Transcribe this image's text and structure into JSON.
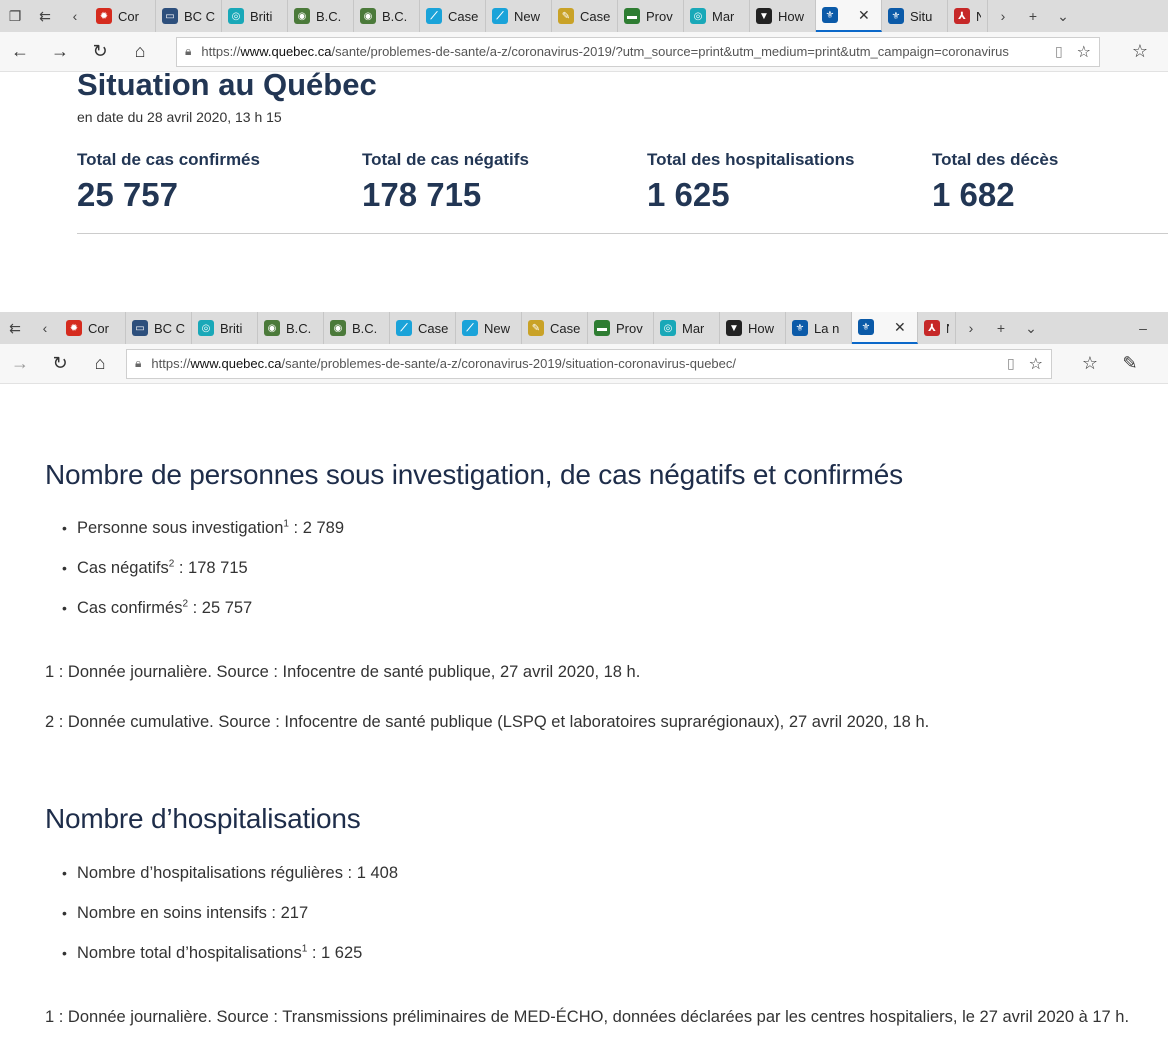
{
  "window1": {
    "tabs": [
      {
        "title": "Cor",
        "fav": "maple-leaf-icon",
        "color": "#d52b1e",
        "glyph": "✹"
      },
      {
        "title": "BC C",
        "fav": "bc-cdc-icon",
        "color": "#2d4f7c",
        "glyph": "▭"
      },
      {
        "title": "Briti",
        "fav": "news-icon",
        "color": "#19a8b8",
        "glyph": "◎"
      },
      {
        "title": "B.C.",
        "fav": "globe-icon",
        "color": "#4b7a3a",
        "glyph": "◉"
      },
      {
        "title": "B.C.",
        "fav": "globe-icon",
        "color": "#4b7a3a",
        "glyph": "◉"
      },
      {
        "title": "Case",
        "fav": "chart-icon",
        "color": "#1aa3d9",
        "glyph": "⟋"
      },
      {
        "title": "New",
        "fav": "chart-icon",
        "color": "#1aa3d9",
        "glyph": "⟋"
      },
      {
        "title": "Case",
        "fav": "doc-icon",
        "color": "#c9a227",
        "glyph": "✎"
      },
      {
        "title": "Prov",
        "fav": "gov-icon",
        "color": "#2e7d32",
        "glyph": "▬"
      },
      {
        "title": "Mar",
        "fav": "news-icon",
        "color": "#19a8b8",
        "glyph": "◎"
      },
      {
        "title": "How",
        "fav": "shield-icon",
        "color": "#222222",
        "glyph": "▼"
      },
      {
        "title": "",
        "fav": "quebec-fleur-icon",
        "color": "#0b5aa8",
        "glyph": "⚜",
        "active": true
      },
      {
        "title": "Situ",
        "fav": "quebec-fleur-icon",
        "color": "#0b5aa8",
        "glyph": "⚜"
      },
      {
        "title": "N",
        "fav": "pdf-icon",
        "color": "#c62828",
        "glyph": "⅄"
      }
    ],
    "url": {
      "prefix": "https://",
      "domain": "www.quebec.ca",
      "path": "/sante/problemes-de-sante/a-z/coronavirus-2019/?utm_source=print&utm_medium=print&utm_campaign=coronavirus"
    }
  },
  "situation": {
    "title": "Situation au Québec",
    "date": "en date du 28 avril 2020, 13 h 15",
    "stats": [
      {
        "label": "Total de cas confirmés",
        "value": "25 757"
      },
      {
        "label": "Total de cas négatifs",
        "value": "178 715"
      },
      {
        "label": "Total des hospitalisations",
        "value": "1 625"
      },
      {
        "label": "Total des décès",
        "value": "1 682"
      }
    ]
  },
  "window2": {
    "tabs": [
      {
        "title": "Cor",
        "fav": "maple-leaf-icon",
        "color": "#d52b1e",
        "glyph": "✹"
      },
      {
        "title": "BC C",
        "fav": "bc-cdc-icon",
        "color": "#2d4f7c",
        "glyph": "▭"
      },
      {
        "title": "Briti",
        "fav": "news-icon",
        "color": "#19a8b8",
        "glyph": "◎"
      },
      {
        "title": "B.C.",
        "fav": "globe-icon",
        "color": "#4b7a3a",
        "glyph": "◉"
      },
      {
        "title": "B.C.",
        "fav": "globe-icon",
        "color": "#4b7a3a",
        "glyph": "◉"
      },
      {
        "title": "Case",
        "fav": "chart-icon",
        "color": "#1aa3d9",
        "glyph": "⟋"
      },
      {
        "title": "New",
        "fav": "chart-icon",
        "color": "#1aa3d9",
        "glyph": "⟋"
      },
      {
        "title": "Case",
        "fav": "doc-icon",
        "color": "#c9a227",
        "glyph": "✎"
      },
      {
        "title": "Prov",
        "fav": "gov-icon",
        "color": "#2e7d32",
        "glyph": "▬"
      },
      {
        "title": "Mar",
        "fav": "news-icon",
        "color": "#19a8b8",
        "glyph": "◎"
      },
      {
        "title": "How",
        "fav": "shield-icon",
        "color": "#222222",
        "glyph": "▼"
      },
      {
        "title": "La n",
        "fav": "quebec-fleur-icon",
        "color": "#0b5aa8",
        "glyph": "⚜"
      },
      {
        "title": "",
        "fav": "quebec-fleur-icon",
        "color": "#0b5aa8",
        "glyph": "⚜",
        "active": true
      },
      {
        "title": "N",
        "fav": "pdf-icon",
        "color": "#c62828",
        "glyph": "⅄"
      }
    ],
    "url": {
      "prefix": "https://",
      "domain": "www.quebec.ca",
      "path": "/sante/problemes-de-sante/a-z/coronavirus-2019/situation-coronavirus-quebec/"
    }
  },
  "section1": {
    "heading": "Nombre de personnes sous investigation, de cas négatifs et confirmés",
    "items": [
      {
        "label": "Personne sous investigation",
        "sup": "1",
        "value": " : 2 789"
      },
      {
        "label": "Cas négatifs",
        "sup": "2",
        "value": " : 178 715"
      },
      {
        "label": "Cas confirmés",
        "sup": "2",
        "value": " : 25 757"
      }
    ],
    "notes": [
      "1 : Donnée journalière. Source : Infocentre de santé publique, 27 avril 2020, 18 h.",
      "2 : Donnée cumulative. Source : Infocentre de santé publique (LSPQ et laboratoires suprarégionaux), 27 avril 2020, 18 h."
    ]
  },
  "section2": {
    "heading": "Nombre d’hospitalisations",
    "items": [
      {
        "label": "Nombre d’hospitalisations régulières",
        "sup": "",
        "value": " : 1 408"
      },
      {
        "label": "Nombre en soins intensifs",
        "sup": "",
        "value": " : 217"
      },
      {
        "label": "Nombre total d’hospitalisations",
        "sup": "1",
        "value": " : 1 625"
      }
    ],
    "notes": [
      "1 : Donnée journalière. Source : Transmissions préliminaires de MED-ÉCHO, données déclarées par les centres hospitaliers, le 27 avril 2020 à 17 h."
    ]
  }
}
